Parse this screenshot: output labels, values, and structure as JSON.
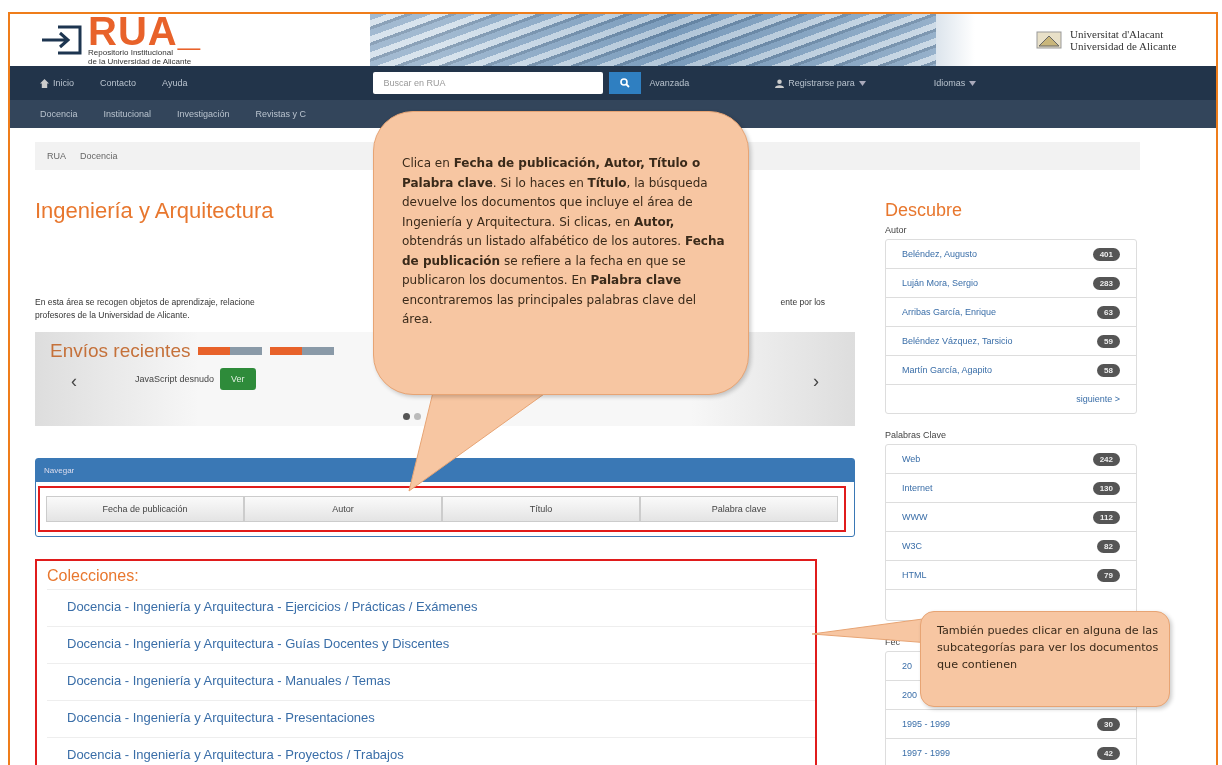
{
  "header": {
    "logo_text": "RUA_",
    "logo_subtitle": [
      "Repositorio Institucional",
      "de la Universidad de Alicante"
    ],
    "university": [
      "Universitat d'Alacant",
      "Universidad de Alicante"
    ]
  },
  "navbar": {
    "links": [
      "Inicio",
      "Contacto",
      "Ayuda"
    ],
    "search": {
      "placeholder": "Buscar en RUA"
    },
    "advanced": "Avanzada",
    "register": "Registrarse para",
    "language": "Idiomas"
  },
  "subnav": [
    "Docencia",
    "Institucional",
    "Investigación",
    "Revistas y C"
  ],
  "breadcrumb": [
    "RUA",
    "Docencia"
  ],
  "page_title": "Ingeniería y Arquitectura",
  "description": {
    "line1_start": "En esta área se recogen objetos de aprendizaje, relacione",
    "line1_end": "ente por los",
    "line2": "profesores de la Universidad de Alicante."
  },
  "recent": {
    "title": "Envíos recientes",
    "item": "JavaScript desnudo",
    "view_button": "Ver",
    "prev": "‹",
    "next": "›",
    "dots": [
      {
        "selected": true
      },
      {
        "selected": false
      }
    ]
  },
  "browse": {
    "title": "Navegar",
    "buttons": [
      "Fecha de publicación",
      "Autor",
      "Título",
      "Palabra clave"
    ]
  },
  "collections": {
    "title": "Colecciones:",
    "items": [
      "Docencia - Ingeniería y Arquitectura - Ejercicios / Prácticas / Exámenes",
      "Docencia - Ingeniería y Arquitectura - Guías Docentes y Discentes",
      "Docencia - Ingeniería y Arquitectura - Manuales / Temas",
      "Docencia - Ingeniería y Arquitectura - Presentaciones",
      "Docencia - Ingeniería y Arquitectura - Proyectos / Trabajos"
    ]
  },
  "sidebar": {
    "title": "Descubre",
    "facets": [
      {
        "title": "Autor",
        "next": "siguiente >",
        "items": [
          {
            "label": "Beléndez, Augusto",
            "count": "401"
          },
          {
            "label": "Luján Mora, Sergio",
            "count": "283"
          },
          {
            "label": "Arribas García, Enrique",
            "count": "63"
          },
          {
            "label": "Beléndez Vázquez, Tarsicio",
            "count": "59"
          },
          {
            "label": "Martín García, Agapito",
            "count": "58"
          }
        ]
      },
      {
        "title": "Palabras Clave",
        "items": [
          {
            "label": "Web",
            "count": "242"
          },
          {
            "label": "Internet",
            "count": "130"
          },
          {
            "label": "WWW",
            "count": "112"
          },
          {
            "label": "W3C",
            "count": "82"
          },
          {
            "label": "HTML",
            "count": "79"
          }
        ]
      },
      {
        "title": "Fec",
        "items": [
          {
            "label": "20"
          },
          {
            "label": "200"
          },
          {
            "label": "1995 - 1999",
            "count": "30"
          },
          {
            "label": "1997 - 1999",
            "count": "42"
          }
        ]
      }
    ]
  },
  "callouts": [
    {
      "text": "Clica en **Fecha de publicación, Autor, Título o Palabra clave**. Si lo haces en **Título**, la búsqueda devuelve los documentos que incluye el área de Ingeniería y Arquitectura. Si clicas, en **Autor,** obtendrás un listado alfabético de los autores. **Fecha de publicación** se refiere a la fecha en que se publicaron los documentos. En **Palabra clave** encontraremos las principales palabras clave del área."
    },
    {
      "text": "También puedes clicar en alguna de las subcategorías para ver los documentos que contienen"
    }
  ]
}
